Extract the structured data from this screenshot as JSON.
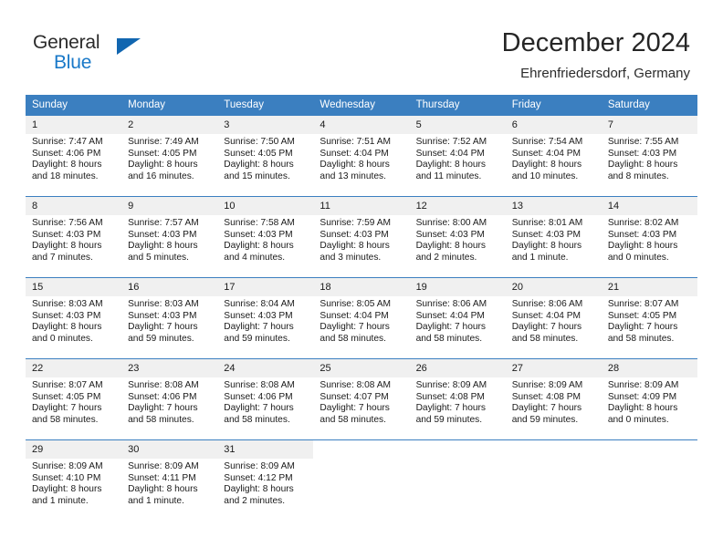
{
  "brand": {
    "name_part1": "General",
    "name_part2": "Blue"
  },
  "header": {
    "title": "December 2024",
    "location": "Ehrenfriedersdorf, Germany"
  },
  "calendar": {
    "weekday_headers": [
      "Sunday",
      "Monday",
      "Tuesday",
      "Wednesday",
      "Thursday",
      "Friday",
      "Saturday"
    ],
    "colors": {
      "header_blue": "#3b7fc0",
      "daynum_bg": "#f0f0f0",
      "brand_blue": "#1878c8",
      "text": "#1a1a1a"
    },
    "weeks": [
      [
        {
          "day": "1",
          "sunrise": "Sunrise: 7:47 AM",
          "sunset": "Sunset: 4:06 PM",
          "daylight": "Daylight: 8 hours and 18 minutes."
        },
        {
          "day": "2",
          "sunrise": "Sunrise: 7:49 AM",
          "sunset": "Sunset: 4:05 PM",
          "daylight": "Daylight: 8 hours and 16 minutes."
        },
        {
          "day": "3",
          "sunrise": "Sunrise: 7:50 AM",
          "sunset": "Sunset: 4:05 PM",
          "daylight": "Daylight: 8 hours and 15 minutes."
        },
        {
          "day": "4",
          "sunrise": "Sunrise: 7:51 AM",
          "sunset": "Sunset: 4:04 PM",
          "daylight": "Daylight: 8 hours and 13 minutes."
        },
        {
          "day": "5",
          "sunrise": "Sunrise: 7:52 AM",
          "sunset": "Sunset: 4:04 PM",
          "daylight": "Daylight: 8 hours and 11 minutes."
        },
        {
          "day": "6",
          "sunrise": "Sunrise: 7:54 AM",
          "sunset": "Sunset: 4:04 PM",
          "daylight": "Daylight: 8 hours and 10 minutes."
        },
        {
          "day": "7",
          "sunrise": "Sunrise: 7:55 AM",
          "sunset": "Sunset: 4:03 PM",
          "daylight": "Daylight: 8 hours and 8 minutes."
        }
      ],
      [
        {
          "day": "8",
          "sunrise": "Sunrise: 7:56 AM",
          "sunset": "Sunset: 4:03 PM",
          "daylight": "Daylight: 8 hours and 7 minutes."
        },
        {
          "day": "9",
          "sunrise": "Sunrise: 7:57 AM",
          "sunset": "Sunset: 4:03 PM",
          "daylight": "Daylight: 8 hours and 5 minutes."
        },
        {
          "day": "10",
          "sunrise": "Sunrise: 7:58 AM",
          "sunset": "Sunset: 4:03 PM",
          "daylight": "Daylight: 8 hours and 4 minutes."
        },
        {
          "day": "11",
          "sunrise": "Sunrise: 7:59 AM",
          "sunset": "Sunset: 4:03 PM",
          "daylight": "Daylight: 8 hours and 3 minutes."
        },
        {
          "day": "12",
          "sunrise": "Sunrise: 8:00 AM",
          "sunset": "Sunset: 4:03 PM",
          "daylight": "Daylight: 8 hours and 2 minutes."
        },
        {
          "day": "13",
          "sunrise": "Sunrise: 8:01 AM",
          "sunset": "Sunset: 4:03 PM",
          "daylight": "Daylight: 8 hours and 1 minute."
        },
        {
          "day": "14",
          "sunrise": "Sunrise: 8:02 AM",
          "sunset": "Sunset: 4:03 PM",
          "daylight": "Daylight: 8 hours and 0 minutes."
        }
      ],
      [
        {
          "day": "15",
          "sunrise": "Sunrise: 8:03 AM",
          "sunset": "Sunset: 4:03 PM",
          "daylight": "Daylight: 8 hours and 0 minutes."
        },
        {
          "day": "16",
          "sunrise": "Sunrise: 8:03 AM",
          "sunset": "Sunset: 4:03 PM",
          "daylight": "Daylight: 7 hours and 59 minutes."
        },
        {
          "day": "17",
          "sunrise": "Sunrise: 8:04 AM",
          "sunset": "Sunset: 4:03 PM",
          "daylight": "Daylight: 7 hours and 59 minutes."
        },
        {
          "day": "18",
          "sunrise": "Sunrise: 8:05 AM",
          "sunset": "Sunset: 4:04 PM",
          "daylight": "Daylight: 7 hours and 58 minutes."
        },
        {
          "day": "19",
          "sunrise": "Sunrise: 8:06 AM",
          "sunset": "Sunset: 4:04 PM",
          "daylight": "Daylight: 7 hours and 58 minutes."
        },
        {
          "day": "20",
          "sunrise": "Sunrise: 8:06 AM",
          "sunset": "Sunset: 4:04 PM",
          "daylight": "Daylight: 7 hours and 58 minutes."
        },
        {
          "day": "21",
          "sunrise": "Sunrise: 8:07 AM",
          "sunset": "Sunset: 4:05 PM",
          "daylight": "Daylight: 7 hours and 58 minutes."
        }
      ],
      [
        {
          "day": "22",
          "sunrise": "Sunrise: 8:07 AM",
          "sunset": "Sunset: 4:05 PM",
          "daylight": "Daylight: 7 hours and 58 minutes."
        },
        {
          "day": "23",
          "sunrise": "Sunrise: 8:08 AM",
          "sunset": "Sunset: 4:06 PM",
          "daylight": "Daylight: 7 hours and 58 minutes."
        },
        {
          "day": "24",
          "sunrise": "Sunrise: 8:08 AM",
          "sunset": "Sunset: 4:06 PM",
          "daylight": "Daylight: 7 hours and 58 minutes."
        },
        {
          "day": "25",
          "sunrise": "Sunrise: 8:08 AM",
          "sunset": "Sunset: 4:07 PM",
          "daylight": "Daylight: 7 hours and 58 minutes."
        },
        {
          "day": "26",
          "sunrise": "Sunrise: 8:09 AM",
          "sunset": "Sunset: 4:08 PM",
          "daylight": "Daylight: 7 hours and 59 minutes."
        },
        {
          "day": "27",
          "sunrise": "Sunrise: 8:09 AM",
          "sunset": "Sunset: 4:08 PM",
          "daylight": "Daylight: 7 hours and 59 minutes."
        },
        {
          "day": "28",
          "sunrise": "Sunrise: 8:09 AM",
          "sunset": "Sunset: 4:09 PM",
          "daylight": "Daylight: 8 hours and 0 minutes."
        }
      ],
      [
        {
          "day": "29",
          "sunrise": "Sunrise: 8:09 AM",
          "sunset": "Sunset: 4:10 PM",
          "daylight": "Daylight: 8 hours and 1 minute."
        },
        {
          "day": "30",
          "sunrise": "Sunrise: 8:09 AM",
          "sunset": "Sunset: 4:11 PM",
          "daylight": "Daylight: 8 hours and 1 minute."
        },
        {
          "day": "31",
          "sunrise": "Sunrise: 8:09 AM",
          "sunset": "Sunset: 4:12 PM",
          "daylight": "Daylight: 8 hours and 2 minutes."
        },
        {
          "day": "",
          "sunrise": "",
          "sunset": "",
          "daylight": ""
        },
        {
          "day": "",
          "sunrise": "",
          "sunset": "",
          "daylight": ""
        },
        {
          "day": "",
          "sunrise": "",
          "sunset": "",
          "daylight": ""
        },
        {
          "day": "",
          "sunrise": "",
          "sunset": "",
          "daylight": ""
        }
      ]
    ]
  }
}
